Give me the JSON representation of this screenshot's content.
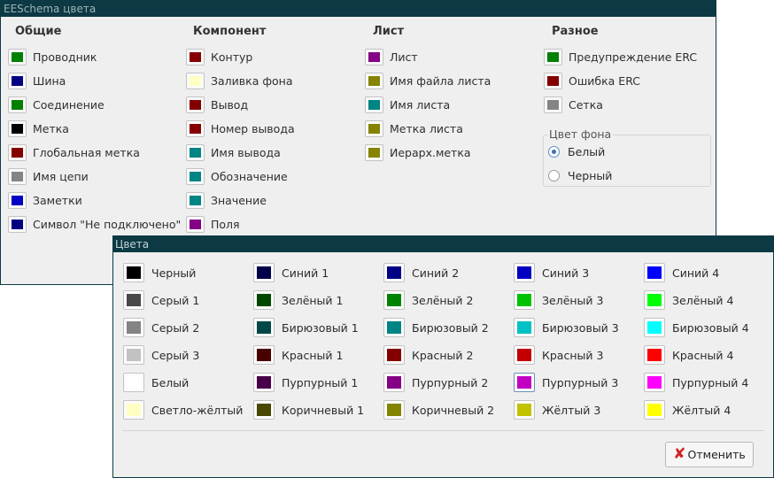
{
  "settings_window": {
    "title": "EESchema цвета",
    "columns": [
      {
        "header": "Общие",
        "items": [
          {
            "label": "Проводник",
            "color": "#008000"
          },
          {
            "label": "Шина",
            "color": "#000080"
          },
          {
            "label": "Соединение",
            "color": "#008000"
          },
          {
            "label": "Метка",
            "color": "#000000"
          },
          {
            "label": "Глобальная метка",
            "color": "#840000"
          },
          {
            "label": "Имя цепи",
            "color": "#848484"
          },
          {
            "label": "Заметки",
            "color": "#0000c2"
          },
          {
            "label": "Символ \"Не подключено\"",
            "color": "#000080"
          }
        ]
      },
      {
        "header": "Компонент",
        "items": [
          {
            "label": "Контур",
            "color": "#840000"
          },
          {
            "label": "Заливка фона",
            "color": "#ffffc2"
          },
          {
            "label": "Вывод",
            "color": "#840000"
          },
          {
            "label": "Номер вывода",
            "color": "#840000"
          },
          {
            "label": "Имя вывода",
            "color": "#008484"
          },
          {
            "label": "Обозначение",
            "color": "#008484"
          },
          {
            "label": "Значение",
            "color": "#008484"
          },
          {
            "label": "Поля",
            "color": "#840084"
          }
        ]
      },
      {
        "header": "Лист",
        "items": [
          {
            "label": "Лист",
            "color": "#840084"
          },
          {
            "label": "Имя файла листа",
            "color": "#848400"
          },
          {
            "label": "Имя листа",
            "color": "#008484"
          },
          {
            "label": "Метка листа",
            "color": "#848400"
          },
          {
            "label": "Иерарх.метка",
            "color": "#848400"
          }
        ]
      },
      {
        "header": "Разное",
        "items": [
          {
            "label": "Предупреждение ERC",
            "color": "#008000"
          },
          {
            "label": "Ошибка ERC",
            "color": "#840000"
          },
          {
            "label": "Сетка",
            "color": "#848484"
          }
        ]
      }
    ],
    "background_group": {
      "title": "Цвет фона",
      "options": [
        {
          "label": "Белый",
          "selected": true
        },
        {
          "label": "Черный",
          "selected": false
        }
      ]
    }
  },
  "colors_dialog": {
    "title": "Цвета",
    "columns": [
      [
        {
          "label": "Черный",
          "color": "#000000"
        },
        {
          "label": "Серый 1",
          "color": "#484848"
        },
        {
          "label": "Серый 2",
          "color": "#848484"
        },
        {
          "label": "Серый 3",
          "color": "#c2c2c2"
        },
        {
          "label": "Белый",
          "color": "#ffffff"
        },
        {
          "label": "Светло-жёлтый",
          "color": "#ffffc2"
        }
      ],
      [
        {
          "label": "Синий 1",
          "color": "#000048"
        },
        {
          "label": "Зелёный 1",
          "color": "#004800"
        },
        {
          "label": "Бирюзовый 1",
          "color": "#004848"
        },
        {
          "label": "Красный 1",
          "color": "#480000"
        },
        {
          "label": "Пурпурный 1",
          "color": "#480048"
        },
        {
          "label": "Коричневый 1",
          "color": "#484800"
        }
      ],
      [
        {
          "label": "Синий 2",
          "color": "#000084"
        },
        {
          "label": "Зелёный 2",
          "color": "#008400"
        },
        {
          "label": "Бирюзовый 2",
          "color": "#008484"
        },
        {
          "label": "Красный 2",
          "color": "#840000"
        },
        {
          "label": "Пурпурный 2",
          "color": "#840084"
        },
        {
          "label": "Коричневый 2",
          "color": "#848400"
        }
      ],
      [
        {
          "label": "Синий 3",
          "color": "#0000c2"
        },
        {
          "label": "Зелёный 3",
          "color": "#00c200"
        },
        {
          "label": "Бирюзовый 3",
          "color": "#00c2c2"
        },
        {
          "label": "Красный 3",
          "color": "#c20000"
        },
        {
          "label": "Пурпурный 3",
          "color": "#c200c2",
          "selected": true
        },
        {
          "label": "Жёлтый 3",
          "color": "#c2c200"
        }
      ],
      [
        {
          "label": "Синий 4",
          "color": "#0000ff"
        },
        {
          "label": "Зелёный 4",
          "color": "#00ff00"
        },
        {
          "label": "Бирюзовый 4",
          "color": "#00ffff"
        },
        {
          "label": "Красный 4",
          "color": "#ff0000"
        },
        {
          "label": "Пурпурный 4",
          "color": "#ff00ff"
        },
        {
          "label": "Жёлтый 4",
          "color": "#ffff00"
        }
      ]
    ],
    "cancel": {
      "label": "Отменить",
      "icon": "red-x-icon"
    }
  }
}
